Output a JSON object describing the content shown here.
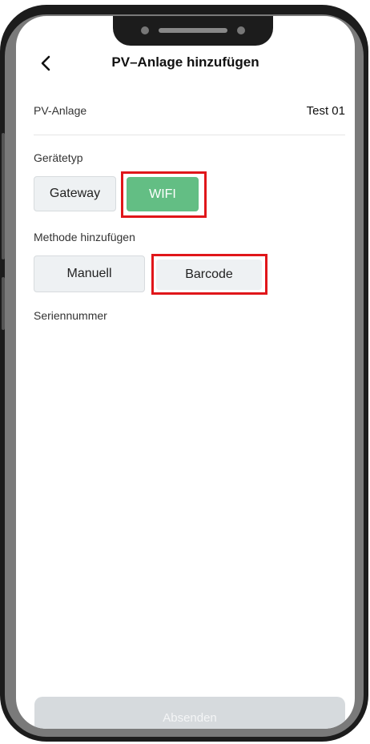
{
  "header": {
    "title": "PV–Anlage hinzufügen"
  },
  "plant_row": {
    "label": "PV-Anlage",
    "value": "Test 01"
  },
  "device_type": {
    "label": "Gerätetyp",
    "options": [
      {
        "label": "Gateway",
        "selected": false
      },
      {
        "label": "WIFI",
        "selected": true
      }
    ]
  },
  "add_method": {
    "label": "Methode hinzufügen",
    "options": [
      {
        "label": "Manuell",
        "selected": false
      },
      {
        "label": "Barcode",
        "selected": true
      }
    ]
  },
  "serial": {
    "label": "Seriennummer"
  },
  "footer": {
    "submit_label": "Absenden"
  },
  "colors": {
    "selected_green": "#63be84",
    "highlight_red": "#e0161a",
    "disabled_button": "#d6dadd"
  }
}
